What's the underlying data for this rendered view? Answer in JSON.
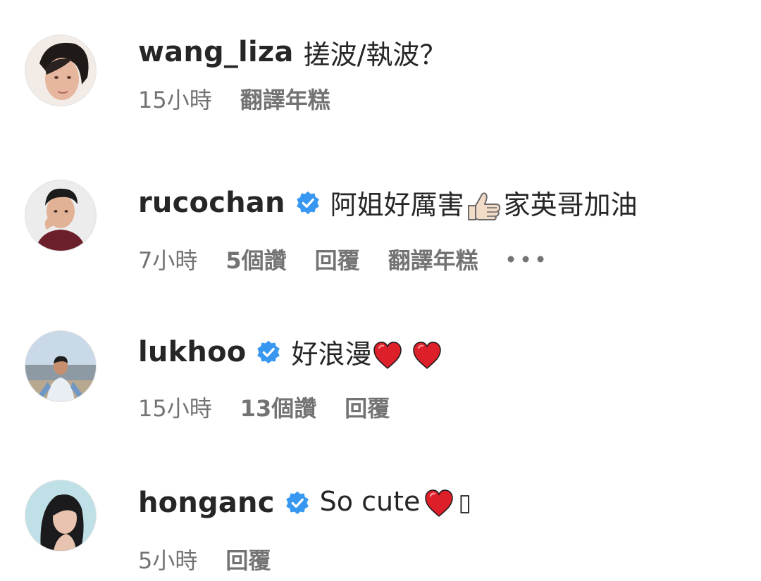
{
  "comments": [
    {
      "username": "wang_liza",
      "verified": false,
      "text": "搓波/執波？",
      "time": "15小時",
      "translate": "翻譯年糕"
    },
    {
      "username": "rucochan",
      "verified": true,
      "text_before_emoji": "阿姐好厲害",
      "emoji": "thumbs-up-emoji",
      "text_after_emoji": "家英哥加油",
      "time": "7小時",
      "likes": "5個讚",
      "reply": "回覆",
      "translate": "翻譯年糕",
      "more_icon": "more-options-icon"
    },
    {
      "username": "lukhoo",
      "verified": true,
      "text": "好浪漫",
      "emojis": [
        "red-heart-emoji",
        "red-heart-emoji"
      ],
      "time": "15小時",
      "likes": "13個讚",
      "reply": "回覆"
    },
    {
      "username": "honganc",
      "verified": true,
      "text": "So cute",
      "emoji": "red-heart-emoji",
      "trailing_glyph": "▯",
      "time": "5小時",
      "reply": "回覆"
    }
  ],
  "colors": {
    "text": "#262626",
    "meta": "#737373",
    "verified_badge": "#3897F0",
    "heart": "#DD1F2A"
  }
}
